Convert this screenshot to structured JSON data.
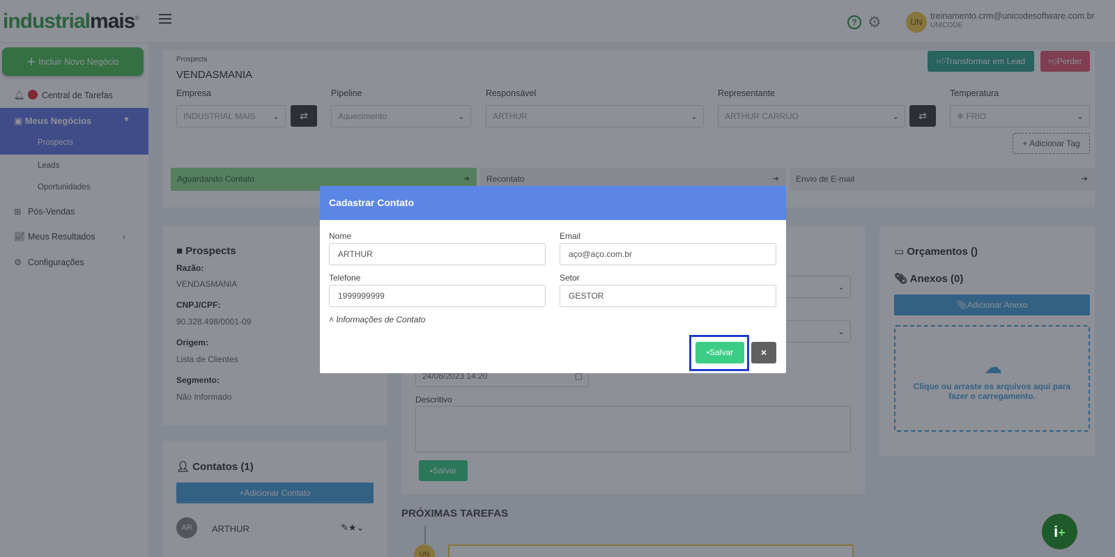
{
  "topbar": {
    "logo_main": "industrial",
    "logo_accent": "mais",
    "logo_mark": "®",
    "help_glyph": "?",
    "gear_glyph": "⚙",
    "avatar_initials": "UN",
    "user_email": "treinamento.crm@unicodesoftware.com.br",
    "user_org": "UNICODE"
  },
  "sidebar": {
    "new_deal_label": "Incluir Novo Negócio",
    "task_center_label": "Central de Tarefas",
    "my_deals_label": "Meus Negócios",
    "prospects_label": "Prospects",
    "leads_label": "Leads",
    "opportunities_label": "Oportunidades",
    "post_sales_label": "Pós-Vendas",
    "results_label": "Meus Resultados",
    "settings_label": "Configurações"
  },
  "header": {
    "breadcrumb": "Prospects",
    "title": "VENDASMANIA",
    "transform_label": "Transformar em Lead",
    "lose_label": "Perder",
    "add_tag_label": "+ Adicionar Tag"
  },
  "fields": {
    "company_label": "Empresa",
    "company_value": "INDUSTRIAL MAIS",
    "pipeline_label": "Pipeline",
    "pipeline_value": "Aquecimento",
    "owner_label": "Responsável",
    "owner_value": "ARTHUR",
    "rep_label": "Representante",
    "rep_value": "ARTHUR CARRIJO",
    "temp_label": "Temperatura",
    "temp_value": "❄ FRIO"
  },
  "stages": [
    "Aguardando Contato",
    "Recontato",
    "Envio de E-mail"
  ],
  "prospect": {
    "section_title": "Prospects",
    "razao_label": "Razão:",
    "razao_value": "VENDASMANIA",
    "cnpj_label": "CNPJ/CPF:",
    "cnpj_value": "90.328.498/0001-09",
    "origem_label": "Origem:",
    "origem_value": "Lista de Clientes",
    "segmento_label": "Segmento:",
    "segmento_value": "Não Informado"
  },
  "contacts": {
    "title": "Contatos (1)",
    "add_label": "Adicionar Contato",
    "first_initials": "AR",
    "first_name": "ARTHUR"
  },
  "activity": {
    "date_value": "24/08/2023 14:20",
    "descritivo_label": "Descritivo",
    "save_label": "Salvar",
    "next_tasks_title": "PRÓXIMAS TAREFAS",
    "timeline_initials": "UN"
  },
  "right_panel": {
    "budgets_title": "Orçamentos ()",
    "attachments_title": "Anexos (0)",
    "add_attachment_label": "Adicionar Anexo",
    "dropzone_text": "Clique ou arraste os arquivos aqui para fazer o carregamento."
  },
  "modal": {
    "title": "Cadastrar Contato",
    "nome_label": "Nome",
    "nome_value": "ARTHUR",
    "email_label": "Email",
    "email_value": "aço@aço.com.br",
    "telefone_label": "Telefone",
    "telefone_value": "1999999999",
    "setor_label": "Setor",
    "setor_value": "GESTOR",
    "contact_info_toggle": "Informações de Contato",
    "save_label": "Salvar",
    "close_glyph": "×"
  },
  "fab": {
    "label": "i"
  }
}
